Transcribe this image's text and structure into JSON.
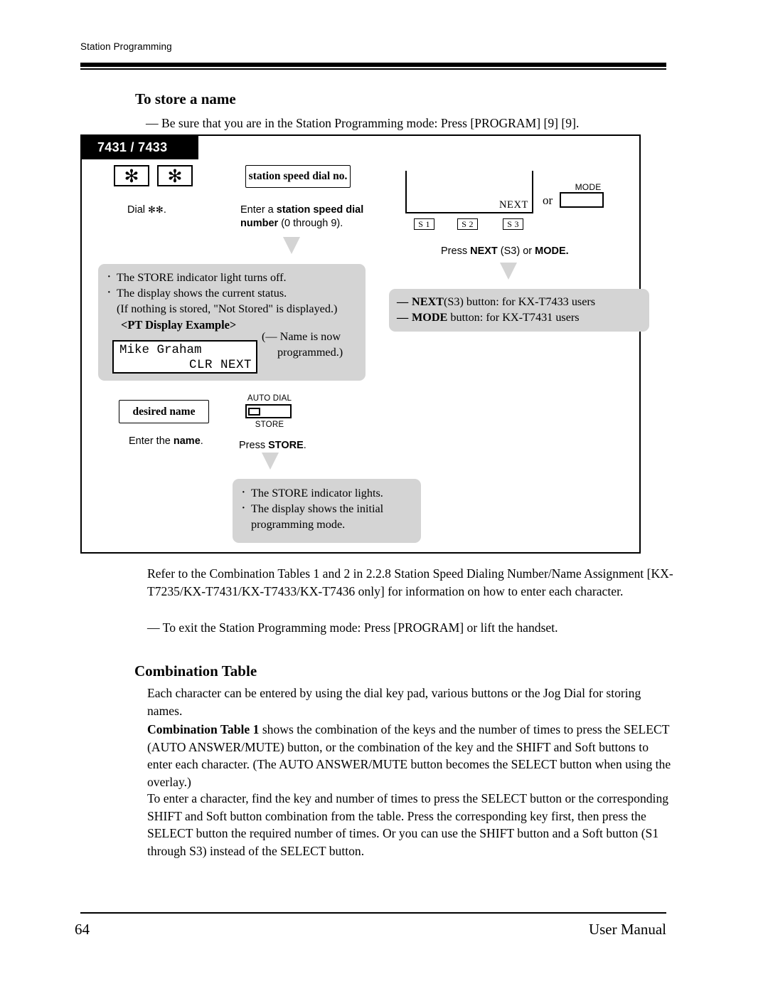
{
  "header": {
    "running_head": "Station Programming"
  },
  "sections": {
    "store_name_heading": "To store a name",
    "intro_line": "— Be sure that you are in the Station Programming mode: Press [PROGRAM] [9] [9].",
    "combination_table_heading": "Combination Table"
  },
  "diagram": {
    "model_tab": "7431 / 7433",
    "step1": {
      "key1": "✻",
      "key2": "✻",
      "caption_prefix": "Dial ",
      "caption_star1": "✻",
      "caption_star2": "✻",
      "caption_suffix": "."
    },
    "step2": {
      "field_label": "station speed dial no.",
      "caption_pre": "Enter a ",
      "caption_bold": "station speed dial number",
      "caption_post": " (0 through 9)."
    },
    "step3": {
      "bracket_label": "NEXT",
      "soft_button_1": "S 1",
      "soft_button_2": "S 2",
      "soft_button_3": "S 3",
      "or_text": "or",
      "mode_label": "MODE",
      "caption_pre": "Press ",
      "caption_bold1": "NEXT",
      "caption_mid": " (S3) or ",
      "caption_bold2": "MODE."
    },
    "step4": {
      "field_label": "desired name",
      "caption_pre": "Enter the ",
      "caption_bold": "name",
      "caption_post": "."
    },
    "step5": {
      "auto_dial_label": "AUTO DIAL",
      "store_label": "STORE",
      "caption_pre": "Press ",
      "caption_bold": "STORE",
      "caption_post": "."
    },
    "callout_store_off": {
      "bullet1": "The STORE indicator light turns off.",
      "bullet2": "The display shows the current status.",
      "sub2": "(If nothing is stored, \"Not Stored\" is displayed.)",
      "pt_display_example_title": "<PT Display Example>",
      "pt_display_line1": "Mike Graham",
      "pt_display_line2": "CLR  NEXT",
      "pt_note_line1": "(— Name is now",
      "pt_note_line2": "programmed.)"
    },
    "callout_next_mode": {
      "row1_bold": "NEXT",
      "row1_rest": "(S3) button: for KX-T7433 users",
      "row2_bold": "MODE",
      "row2_rest": " button: for KX-T7431 users"
    },
    "callout_store_on": {
      "bullet1": "The STORE indicator lights.",
      "bullet2": "The display shows the initial",
      "sub2": "programming mode."
    }
  },
  "body": {
    "refer_paragraph": "Refer to the Combination Tables 1 and 2 in 2.2.8    Station Speed Dialing Number/Name Assignment [KX-T7235/KX-T7431/KX-T7433/KX-T7436 only] for information on how to enter each character.",
    "exit_paragraph": "— To exit the Station Programming mode: Press [PROGRAM] or lift the handset.",
    "each_character_paragraph": "Each character can be entered by using the dial key pad, various buttons or the Jog Dial for storing names.",
    "table1_bold": "Combination Table 1",
    "table1_rest": " shows the combination of the keys and the number of times to press the SELECT (AUTO ANSWER/MUTE) button, or the combination of the key and the SHIFT and Soft buttons to enter each character. (The AUTO ANSWER/MUTE button becomes the SELECT button when using the overlay.)",
    "enter_character_paragraph": "To enter a character, find the key and number of times to press the SELECT button or the corresponding SHIFT and Soft button combination from the table. Press the corresponding key first, then press the SELECT button the required number of times. Or you can use the SHIFT button and a Soft button (S1 through S3) instead of the SELECT button."
  },
  "footer": {
    "page_number": "64",
    "document_title": "User Manual"
  }
}
